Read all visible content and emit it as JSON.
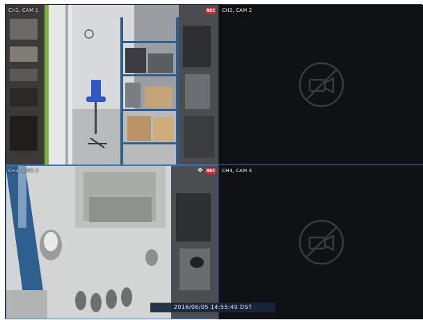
{
  "cameras": [
    {
      "label": "CH1, CAM 1"
    },
    {
      "label": "CH2, CAM 2"
    },
    {
      "label": "CH3, CAM 3"
    },
    {
      "label": "CH4, CAM 4"
    }
  ],
  "rec_badge": "REC",
  "timestamp": "2016/06/05 14:55:49 DST",
  "icons": {
    "record": "record-icon",
    "ptz": "move-arrows-icon",
    "no_video": "no-video-camera-slashed-icon"
  },
  "colors": {
    "record_badge": "#d8262c",
    "selection_border": "#3b74c2",
    "background": "#0c0d10",
    "timestamp_bar": "#1a263c"
  }
}
